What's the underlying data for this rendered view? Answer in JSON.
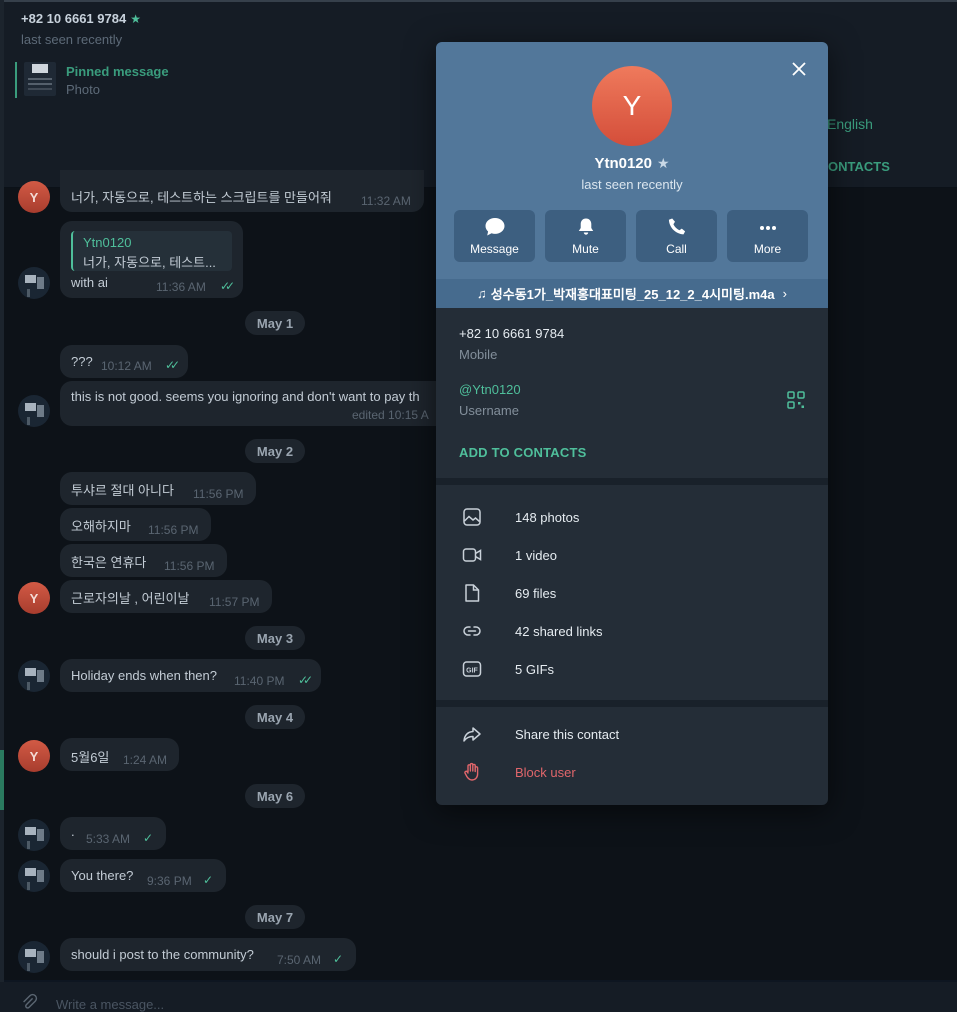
{
  "chat": {
    "contact_phone": "+82 10 6661 9784",
    "contact_status": "last seen recently",
    "pinned_title": "Pinned message",
    "pinned_sub": "Photo",
    "header_right_link": "English",
    "header_right_button": "ONTACTS",
    "composer_placeholder": "Write a message...",
    "messages": [
      {
        "text": "너가, 자동으로, 테스트하는 스크립트를 만들어줘",
        "time": "11:32 AM"
      },
      {
        "quote_name": "Ytn0120",
        "quote_text": "너가, 자동으로, 테스트...",
        "text": "with ai",
        "time": "11:36 AM"
      },
      {
        "date": "May 1"
      },
      {
        "text": "???",
        "time": "10:12 AM"
      },
      {
        "text": "this is not good. seems you ignoring and don't want to pay th",
        "time": "edited 10:15 A"
      },
      {
        "date": "May 2"
      },
      {
        "text": "투샤르 절대 아니다",
        "time": "11:56 PM"
      },
      {
        "text": "오해하지마",
        "time": "11:56 PM"
      },
      {
        "text": "한국은 연휴다",
        "time": "11:56 PM"
      },
      {
        "text": "근로자의날 , 어린이날",
        "time": "11:57 PM"
      },
      {
        "date": "May 3"
      },
      {
        "text": "Holiday ends when then?",
        "time": "11:40 PM"
      },
      {
        "date": "May 4"
      },
      {
        "text": "5월6일",
        "time": "1:24 AM"
      },
      {
        "date": "May 6"
      },
      {
        "text": ".",
        "time": "5:33 AM"
      },
      {
        "text": "You there?",
        "time": "9:36 PM"
      },
      {
        "date": "May 7"
      },
      {
        "text": "should i post to the community?",
        "time": "7:50 AM"
      }
    ],
    "avatar_letter": "Y"
  },
  "profile": {
    "avatar_letter": "Y",
    "name": "Ytn0120",
    "status": "last seen recently",
    "actions": [
      {
        "label": "Message",
        "icon": "message-icon"
      },
      {
        "label": "Mute",
        "icon": "bell-icon"
      },
      {
        "label": "Call",
        "icon": "phone-icon"
      },
      {
        "label": "More",
        "icon": "more-icon"
      }
    ],
    "music_note": "♫",
    "music_title": "성수동1가_박재홍대표미팅_25_12_2_4시미팅.m4a",
    "music_chevron": "›",
    "phone": "+82 10 6661 9784",
    "phone_label": "Mobile",
    "username": "@Ytn0120",
    "username_label": "Username",
    "add_contacts": "ADD TO CONTACTS",
    "media": [
      {
        "label": "148 photos",
        "icon": "photo-icon"
      },
      {
        "label": "1 video",
        "icon": "video-icon"
      },
      {
        "label": "69 files",
        "icon": "file-icon"
      },
      {
        "label": "42 shared links",
        "icon": "link-icon"
      },
      {
        "label": "5 GIFs",
        "icon": "gif-icon"
      }
    ],
    "share_contact": "Share this contact",
    "block_user": "Block user"
  },
  "colors": {
    "accent": "#4fbf9b",
    "modal_header": "#52779a",
    "danger": "#e1666b"
  }
}
